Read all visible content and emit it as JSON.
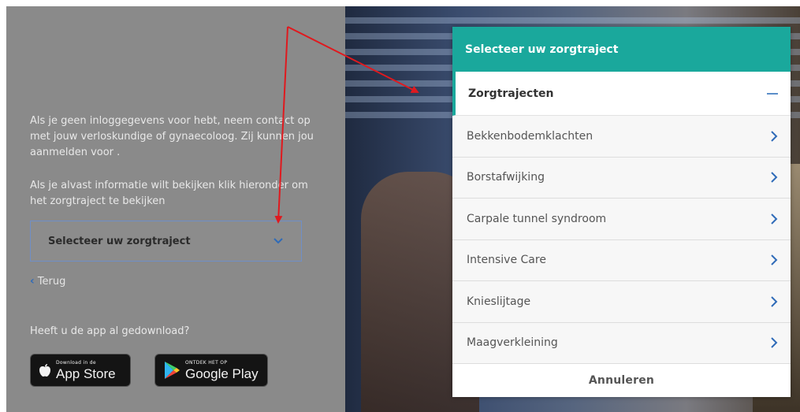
{
  "left": {
    "intro_text": "Als je geen inloggegevens voor hebt, neem contact op met jouw verloskundige of gynaecoloog. Zij kunnen jou aanmelden voor .",
    "info_text": "Als je alvast informatie wilt bekijken klik hieronder om het zorgtraject te bekijken",
    "select_label": "Selecteer uw zorgtraject",
    "back_label": "Terug",
    "app_question": "Heeft u de app al gedownload?",
    "app_store": {
      "small": "Download in de",
      "big": "App Store"
    },
    "google_play": {
      "small": "ONTDEK HET OP",
      "big": "Google Play"
    }
  },
  "modal": {
    "title": "Selecteer uw zorgtraject",
    "section": "Zorgtrajecten",
    "items": [
      {
        "label": "Bekkenbodemklachten"
      },
      {
        "label": "Borstafwijking"
      },
      {
        "label": "Carpale tunnel syndroom"
      },
      {
        "label": "Intensive Care"
      },
      {
        "label": "Knieslijtage"
      },
      {
        "label": "Maagverkleining"
      }
    ],
    "cancel_label": "Annuleren"
  },
  "colors": {
    "accent": "#1aa89c",
    "link_blue": "#2f6bb8",
    "arrow_red": "#e0191e",
    "dim_gray": "#8a8a8a"
  }
}
